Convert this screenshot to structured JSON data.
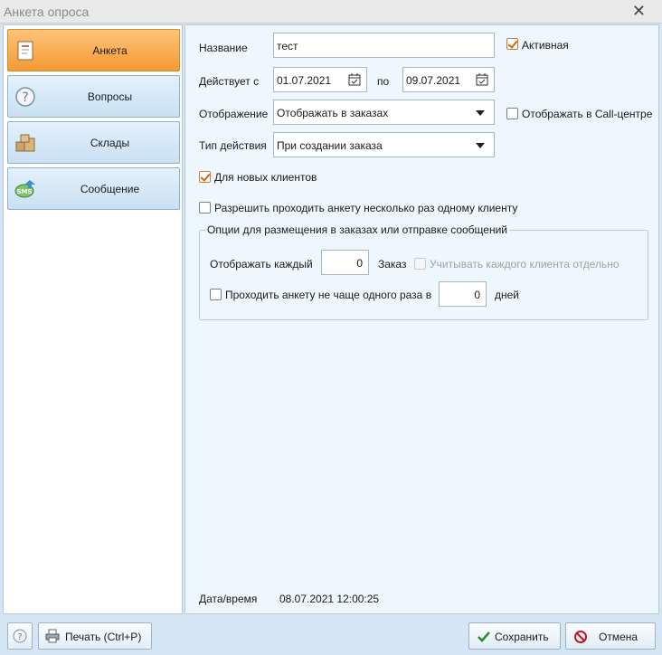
{
  "window": {
    "title": "Анкета опроса"
  },
  "sidebar": {
    "items": [
      {
        "label": "Анкета",
        "icon": "form-icon"
      },
      {
        "label": "Вопросы",
        "icon": "question-icon"
      },
      {
        "label": "Склады",
        "icon": "boxes-icon"
      },
      {
        "label": "Сообщение",
        "icon": "sms-icon"
      }
    ]
  },
  "form": {
    "name_label": "Название",
    "name_value": "тест",
    "active_label": "Активная",
    "active_checked": true,
    "valid_from_label": "Действует с",
    "valid_from_value": "01.07.2021",
    "valid_to_label": "по",
    "valid_to_value": "09.07.2021",
    "display_label": "Отображение",
    "display_value": "Отображать в заказах",
    "callcenter_label": "Отображать в Call-центре",
    "callcenter_checked": false,
    "action_type_label": "Тип действия",
    "action_type_value": "При создании заказа",
    "new_clients_label": "Для новых клиентов",
    "new_clients_checked": true,
    "multi_label": "Разрешить проходить анкету несколько раз одному клиенту",
    "multi_checked": false
  },
  "options": {
    "group_title": "Опции для размещения в заказах или отправке сообщений",
    "show_every_label": "Отображать каждый",
    "show_every_value": "0",
    "order_unit": "Заказ",
    "each_client_label": "Учитывать каждого клиента отдельно",
    "once_per_label": "Проходить анкету не чаще одного раза в",
    "once_per_value": "0",
    "days_unit": "дней"
  },
  "footer": {
    "datetime_label": "Дата/время",
    "datetime_value": "08.07.2021 12:00:25"
  },
  "toolbar": {
    "help_label": "?",
    "print_label": "Печать (Ctrl+P)",
    "save_label": "Сохранить",
    "cancel_label": "Отмена"
  },
  "colors": {
    "active_nav": "#f39a32",
    "nav_bg": "#c9e0f3",
    "content_bg": "#eef7fd",
    "save_check": "#2e8b2e",
    "cancel_red": "#c4161c"
  }
}
